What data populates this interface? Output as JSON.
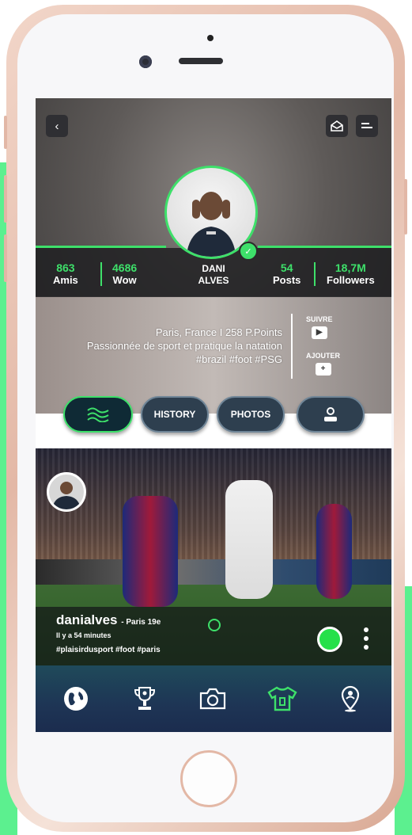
{
  "profile": {
    "name_first": "DANI",
    "name_last": "ALVES",
    "stats": {
      "amis": {
        "value": "863",
        "label": "Amis"
      },
      "wow": {
        "value": "4686",
        "label": "Wow"
      },
      "posts": {
        "value": "54",
        "label": "Posts"
      },
      "followers": {
        "value": "18,7M",
        "label": "Followers"
      }
    },
    "bio": {
      "line1": "Paris, France  I  258 P.Points",
      "line2": "Passionnée de sport et pratique la natation",
      "line3": "#brazil #foot #PSG"
    },
    "actions": {
      "follow_label": "SUIVRE",
      "add_label": "AJOUTER"
    }
  },
  "tabs": [
    {
      "label": "",
      "icon": "waves-icon",
      "active": true
    },
    {
      "label": "HISTORY",
      "icon": "",
      "active": false
    },
    {
      "label": "PHOTOS",
      "icon": "",
      "active": false
    },
    {
      "label": "",
      "icon": "user-icon",
      "active": false
    }
  ],
  "post": {
    "username": "danialves",
    "location": "- Paris 19e",
    "time": "Il y a 54 minutes",
    "tags": "#plaisirdusport #foot #paris"
  },
  "bottom_nav": [
    "globe-icon",
    "trophy-icon",
    "camera-icon",
    "jersey-icon",
    "map-pin-icon"
  ],
  "colors": {
    "accent": "#3ee06a",
    "nav_bg": "#1e3555",
    "tab_bg": "#2e3f4f",
    "side_green": "#5cf08f"
  }
}
